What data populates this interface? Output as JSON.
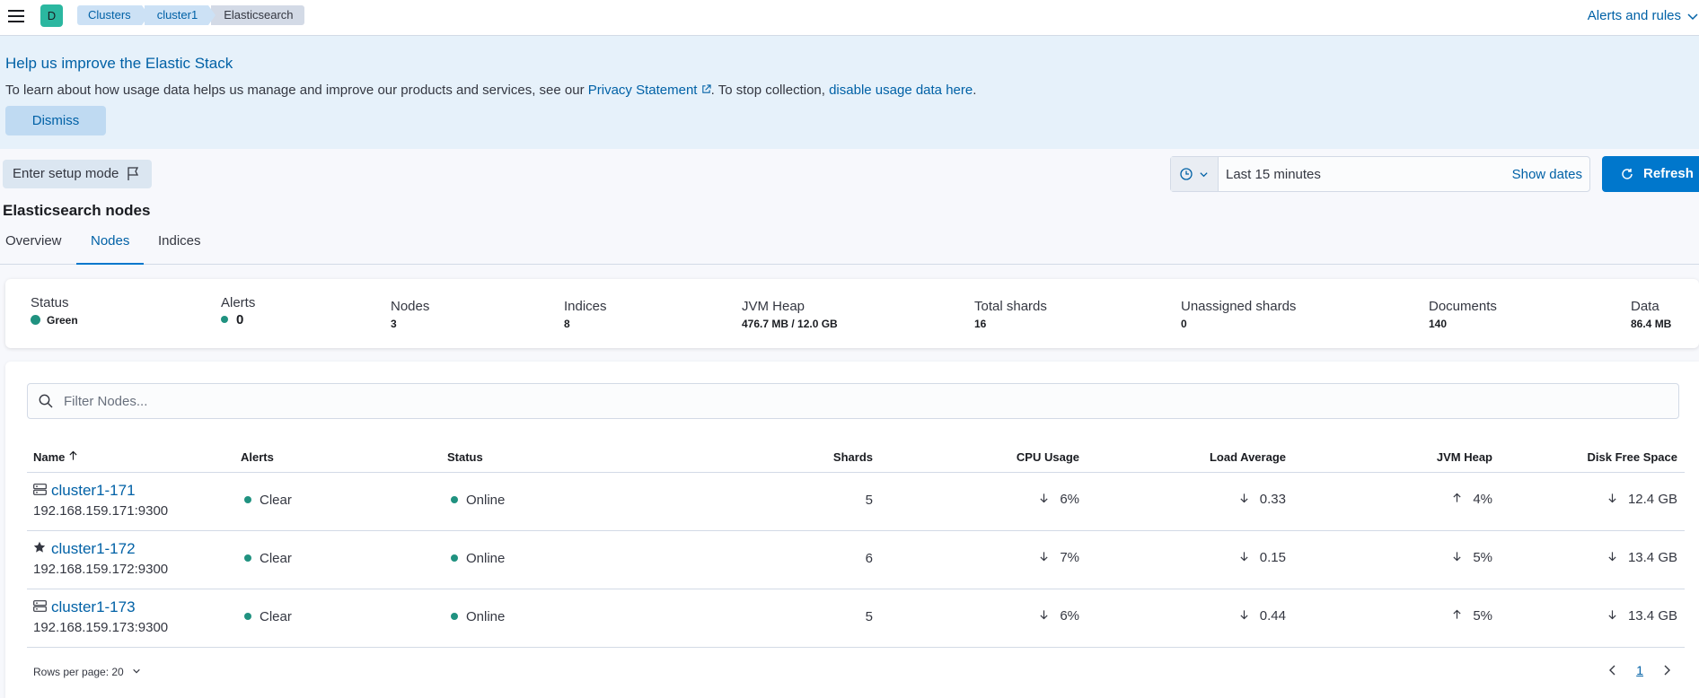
{
  "header": {
    "space_initial": "D",
    "breadcrumbs": [
      "Clusters",
      "cluster1",
      "Elasticsearch"
    ],
    "alerts_menu": "Alerts and rules"
  },
  "callout": {
    "title": "Help us improve the Elastic Stack",
    "text_before": "To learn about how usage data helps us manage and improve our products and services, see our ",
    "privacy_link": "Privacy Statement",
    "text_middle": ". To stop collection, ",
    "disable_link": "disable usage data here",
    "text_after": ".",
    "dismiss_label": "Dismiss"
  },
  "controls": {
    "setup_mode_label": "Enter setup mode",
    "time_range": "Last 15 minutes",
    "show_dates": "Show dates",
    "refresh_label": "Refresh"
  },
  "page": {
    "title": "Elasticsearch nodes",
    "tabs": [
      "Overview",
      "Nodes",
      "Indices"
    ],
    "active_tab": "Nodes"
  },
  "summary": {
    "status_label": "Status",
    "status_value": "Green",
    "alerts_label": "Alerts",
    "alerts_value": "0",
    "nodes_label": "Nodes",
    "nodes_value": "3",
    "indices_label": "Indices",
    "indices_value": "8",
    "jvm_label": "JVM Heap",
    "jvm_value": "476.7 MB / 12.0 GB",
    "shards_label": "Total shards",
    "shards_value": "16",
    "unassigned_label": "Unassigned shards",
    "unassigned_value": "0",
    "docs_label": "Documents",
    "docs_value": "140",
    "data_label": "Data",
    "data_value": "86.4 MB",
    "status_color": "#209280"
  },
  "table": {
    "filter_placeholder": "Filter Nodes...",
    "columns": [
      "Name",
      "Alerts",
      "Status",
      "Shards",
      "CPU Usage",
      "Load Average",
      "JVM Heap",
      "Disk Free Space"
    ],
    "rows": [
      {
        "name": "cluster1-171",
        "address": "192.168.159.171:9300",
        "icon": "server-icon",
        "alerts": "Clear",
        "status": "Online",
        "shards": "5",
        "cpu": "6%",
        "cpu_trend": "down",
        "load": "0.33",
        "load_trend": "down",
        "jvm": "4%",
        "jvm_trend": "up",
        "disk": "12.4 GB",
        "disk_trend": "down"
      },
      {
        "name": "cluster1-172",
        "address": "192.168.159.172:9300",
        "icon": "star-icon",
        "alerts": "Clear",
        "status": "Online",
        "shards": "6",
        "cpu": "7%",
        "cpu_trend": "down",
        "load": "0.15",
        "load_trend": "down",
        "jvm": "5%",
        "jvm_trend": "down",
        "disk": "13.4 GB",
        "disk_trend": "down"
      },
      {
        "name": "cluster1-173",
        "address": "192.168.159.173:9300",
        "icon": "server-icon",
        "alerts": "Clear",
        "status": "Online",
        "shards": "5",
        "cpu": "6%",
        "cpu_trend": "down",
        "load": "0.44",
        "load_trend": "down",
        "jvm": "5%",
        "jvm_trend": "up",
        "disk": "13.4 GB",
        "disk_trend": "down"
      }
    ],
    "rows_per_page": "Rows per page: 20",
    "current_page": "1"
  }
}
